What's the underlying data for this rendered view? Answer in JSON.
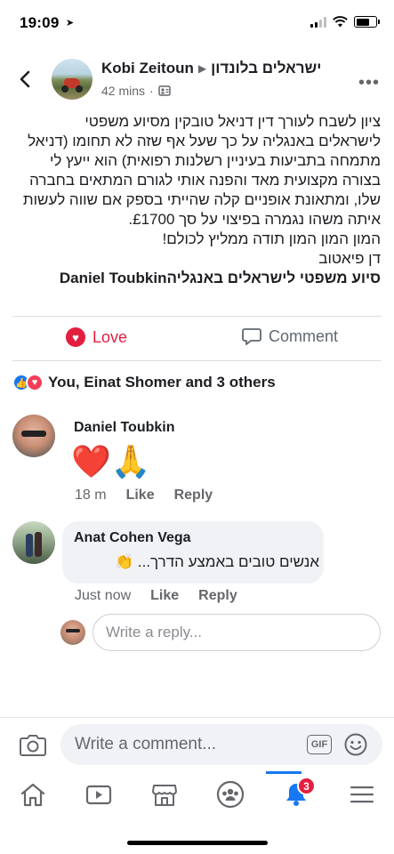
{
  "status_bar": {
    "time": "19:09"
  },
  "header": {
    "author": "Kobi Zeitoun",
    "group": "ישראלים בלונדון",
    "time_ago": "42 mins"
  },
  "post": {
    "lines": [
      "ציון לשבח לעורך דין דניאל טובקין מסיוע משפטי",
      "לישראלים באנגליה על כך שעל אף שזה לא תחומו (דניאל",
      "מתמחה בתביעות בעיניין רשלנות רפואית) הוא ייעץ לי",
      "בצורה מקצועית מאד  והפנה אותי לגורם המתאים בחברה",
      "שלו, ומתאונת אופניים קלה שהייתי בספק אם שווה לעשות",
      "איתה משהו נגמרה בפיצוי על סך £1700.",
      "המון המון המון תודה ממליץ לכולם!",
      "דן פיאטוב"
    ],
    "signature": "סיוע משפטי לישראלים באנגליהDaniel Toubkin"
  },
  "actions": {
    "love": "Love",
    "comment": "Comment"
  },
  "reactions": {
    "summary": "You, Einat Shomer and 3 others"
  },
  "comments": [
    {
      "name": "Daniel Toubkin",
      "emoji": "❤️🙏",
      "time": "18 m",
      "like": "Like",
      "reply": "Reply"
    },
    {
      "name": "Anat Cohen Vega",
      "text": "אנשים טובים באמצע הדרך... 👏",
      "time": "Just now",
      "like": "Like",
      "reply": "Reply"
    }
  ],
  "reply_input": {
    "placeholder": "Write a reply..."
  },
  "comment_input": {
    "placeholder": "Write a comment..."
  },
  "composer": {
    "gif": "GIF"
  },
  "tabbar": {
    "notifications_badge": "3"
  },
  "colors": {
    "brand_blue": "#1877f2",
    "love_red": "#e41e3f"
  }
}
